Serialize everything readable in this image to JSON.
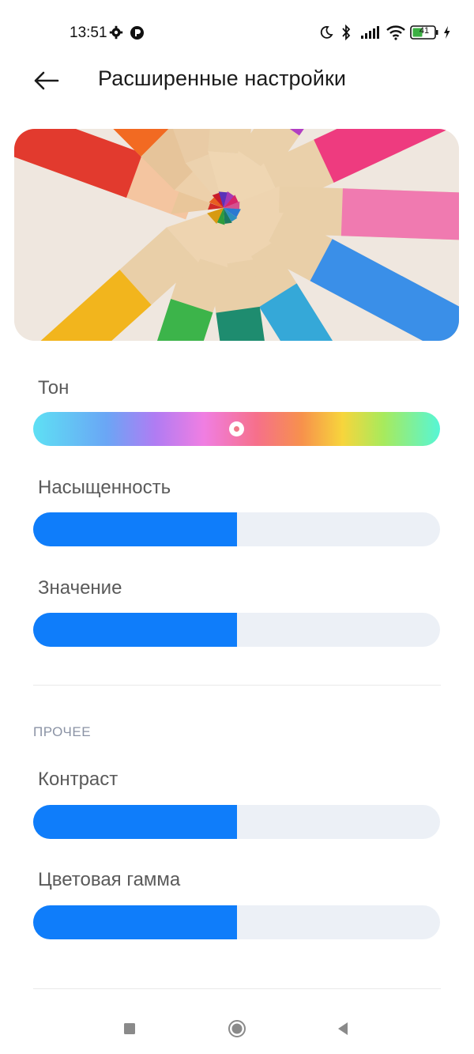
{
  "status_bar": {
    "time": "13:51",
    "battery": "41",
    "icons": [
      "settings-gear-icon",
      "app-notification-icon",
      "moon-icon",
      "bluetooth-icon",
      "signal-icon",
      "wifi-icon",
      "battery-icon",
      "charging-icon"
    ]
  },
  "header": {
    "back_icon": "arrow-left-icon",
    "title": "Расширенные настройки"
  },
  "banner": {
    "image": "colored-pencils-image"
  },
  "sliders": {
    "hue": {
      "label": "Тон",
      "value_fraction": 0.5
    },
    "saturation": {
      "label": "Насыщенность",
      "value_fraction": 0.5
    },
    "value": {
      "label": "Значение",
      "value_fraction": 0.5
    }
  },
  "other": {
    "section_title": "ПРОЧЕЕ",
    "contrast": {
      "label": "Контраст",
      "value_fraction": 0.5
    },
    "gamut": {
      "label": "Цветовая гамма",
      "value_fraction": 0.5
    }
  },
  "colors": {
    "accent": "#0f7dfa",
    "track": "#ecf0f6",
    "label": "#5a5a5a",
    "section": "#8b93a5"
  },
  "navbar": {
    "icons": [
      "recents-square-icon",
      "home-circle-icon",
      "back-triangle-icon"
    ]
  }
}
